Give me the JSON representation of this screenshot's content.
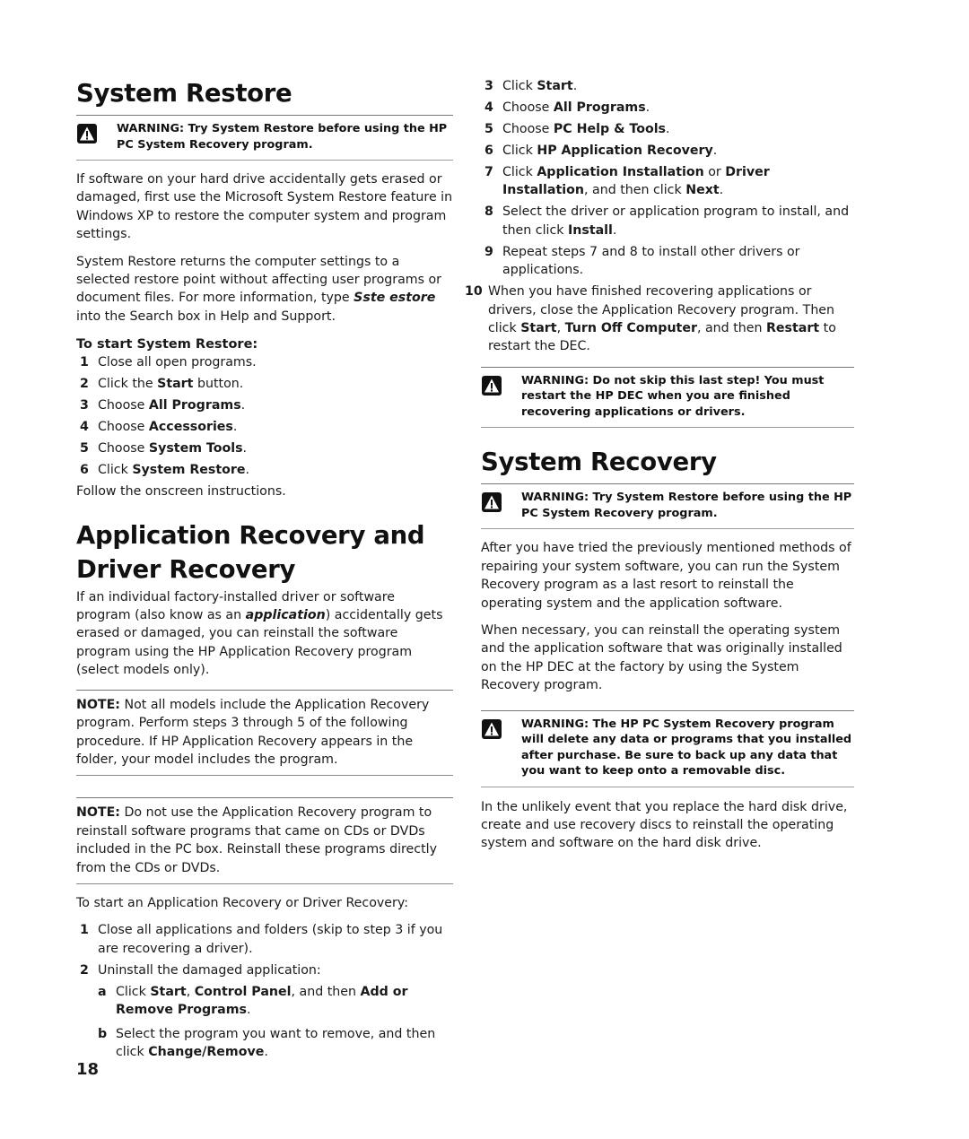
{
  "left": {
    "system_restore": {
      "title": "System Restore",
      "warning": "WARNING: Try System Restore before using the HP PC System Recovery program.",
      "para1": "If software on your hard drive accidentally gets erased or damaged, first use the Microsoft System Restore feature in Windows XP to restore the computer system and program settings.",
      "para2_before": "System Restore returns the computer settings to a selected restore point without affecting user programs or document files. For more information, type ",
      "para2_term": "Sste estore",
      "para2_after": "  into the Search box in Help and Support.",
      "steps_heading": "To start System Restore:",
      "steps": [
        {
          "num": "1",
          "pre": "Close all open programs.",
          "bold": "",
          "post": ""
        },
        {
          "num": "2",
          "pre": "Click the ",
          "bold": "Start",
          "post": " button."
        },
        {
          "num": "3",
          "pre": "Choose ",
          "bold": "All Programs",
          "post": "."
        },
        {
          "num": "4",
          "pre": "Choose ",
          "bold": "Accessories",
          "post": "."
        },
        {
          "num": "5",
          "pre": "Choose ",
          "bold": "System Tools",
          "post": "."
        },
        {
          "num": "6",
          "pre": "Click ",
          "bold": "System Restore",
          "post": "."
        }
      ],
      "follow": "Follow the onscreen instructions."
    },
    "app_recovery": {
      "title_line1": "Application Recovery and",
      "title_line2": "Driver Recovery",
      "para1_before": "If an individual factory-installed driver or software program (also know as an ",
      "para1_term": "application",
      "para1_after": ") accidentally gets erased or damaged, you can reinstall the software program using the HP Application Recovery program (select models only).",
      "note1_label": "NOTE:",
      "note1_text": " Not all models include the Application Recovery program. Perform steps 3 through 5 of the following procedure. If HP Application Recovery appears in the folder, your model includes the program.",
      "note2_label": "NOTE:",
      "note2_text": " Do not use the Application Recovery program to reinstall software programs that came on CDs or DVDs included in the PC box. Reinstall these programs directly from the CDs or DVDs.",
      "intro": "To start an Application Recovery or Driver Recovery:",
      "step1_num": "1",
      "step1": "Close all applications and folders (skip to step 3 if you are recovering a driver).",
      "step2_num": "2",
      "step2": "Uninstall the damaged application:",
      "sub_a_num": "a",
      "sub_a": {
        "t1": "Click ",
        "b1": "Start",
        "t2": ", ",
        "b2": "Control Panel",
        "t3": ", and then ",
        "b3": "Add or Remove Programs",
        "t4": "."
      },
      "sub_b_num": "b",
      "sub_b": {
        "t1": "Select the program you want to remove, and then click ",
        "b1": "Change/Remove",
        "t2": "."
      }
    }
  },
  "right": {
    "steps": [
      {
        "num": "3",
        "html": [
          [
            "Click ",
            false
          ],
          [
            "Start",
            true
          ],
          [
            ".",
            false
          ]
        ]
      },
      {
        "num": "4",
        "html": [
          [
            "Choose ",
            false
          ],
          [
            "All Programs",
            true
          ],
          [
            ".",
            false
          ]
        ]
      },
      {
        "num": "5",
        "html": [
          [
            "Choose ",
            false
          ],
          [
            "PC Help & Tools",
            true
          ],
          [
            ".",
            false
          ]
        ]
      },
      {
        "num": "6",
        "html": [
          [
            "Click ",
            false
          ],
          [
            "HP Application Recovery",
            true
          ],
          [
            ".",
            false
          ]
        ]
      },
      {
        "num": "7",
        "html": [
          [
            "Click ",
            false
          ],
          [
            "Application Installation",
            true
          ],
          [
            " or ",
            false
          ],
          [
            "Driver Installation",
            true
          ],
          [
            ", and then click ",
            false
          ],
          [
            "Next",
            true
          ],
          [
            ".",
            false
          ]
        ]
      },
      {
        "num": "8",
        "html": [
          [
            "Select the driver or application program to install, and then click ",
            false
          ],
          [
            "Install",
            true
          ],
          [
            ".",
            false
          ]
        ]
      },
      {
        "num": "9",
        "html": [
          [
            "Repeat steps 7 and 8 to install other drivers or applications.",
            false
          ]
        ]
      },
      {
        "num": "10",
        "html": [
          [
            "When you have finished recovering applications or drivers, close the Application Recovery program. Then click ",
            false
          ],
          [
            "Start",
            true
          ],
          [
            ", ",
            false
          ],
          [
            "Turn Off Computer",
            true
          ],
          [
            ", and then ",
            false
          ],
          [
            "Restart",
            true
          ],
          [
            " to restart the DEC.",
            false
          ]
        ]
      }
    ],
    "warning_restart": "WARNING: Do not skip this last step! You must restart the HP DEC when you are finished recovering applications or drivers.",
    "system_recovery": {
      "title": "System Recovery",
      "warning": "WARNING: Try System Restore before using the HP PC System Recovery program.",
      "para1": "After you have tried the previously mentioned methods of repairing your system software, you can run the System Recovery program as a last resort to reinstall the operating system and the application software.",
      "para2": "When necessary, you can reinstall the operating system and the application software that was originally installed on the HP DEC at the factory by using the System Recovery program.",
      "warning2": "WARNING: The HP PC System Recovery program will delete any data or programs that you installed after purchase. Be sure to back up any data that you want to keep onto a removable disc.",
      "para3": "In the unlikely event that you replace the hard disk drive, create and use recovery discs to reinstall the operating system and software on the hard disk drive."
    }
  },
  "footer": {
    "page_number": "18"
  },
  "icons": {
    "warning": "warning-triangle-icon"
  }
}
